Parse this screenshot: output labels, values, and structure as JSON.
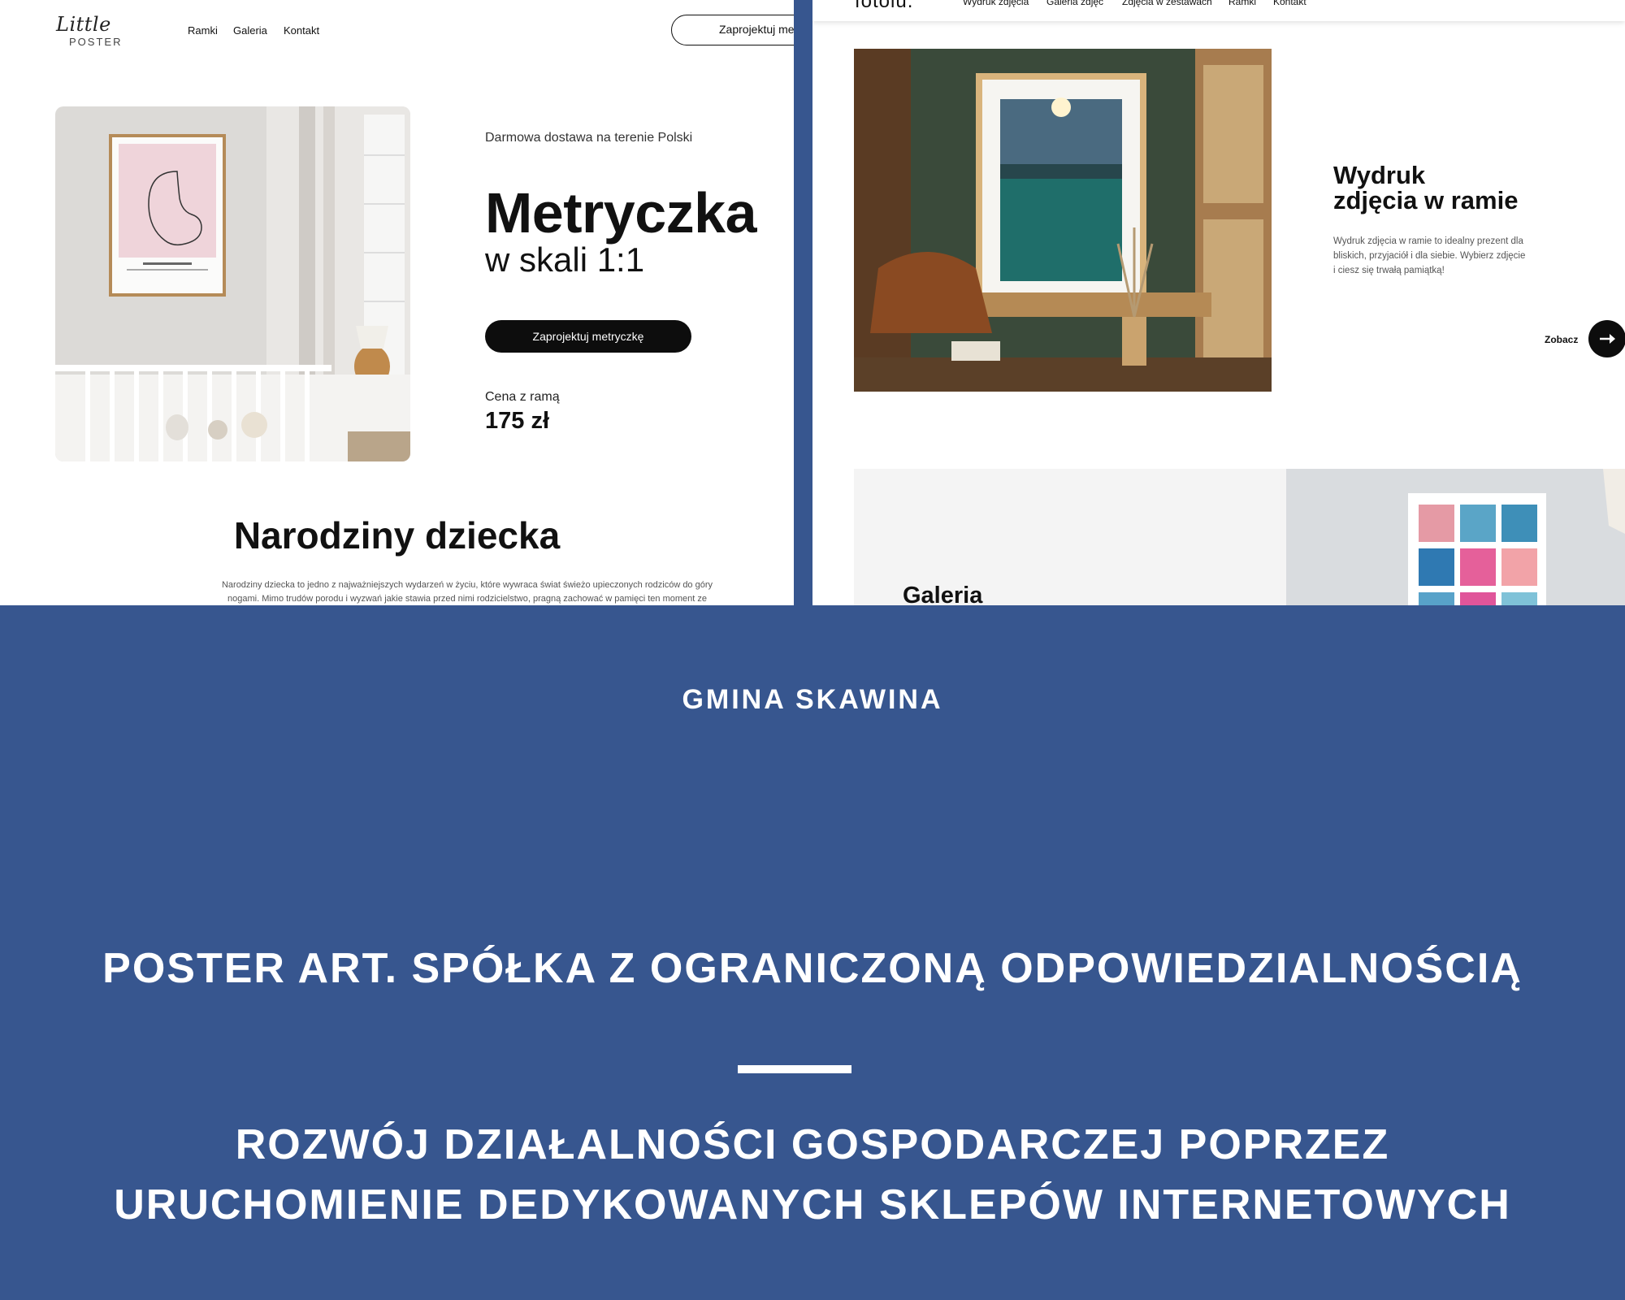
{
  "left_site": {
    "logo_script": "Little",
    "logo_caps": "POSTER",
    "nav": [
      "Ramki",
      "Galeria",
      "Kontakt"
    ],
    "header_cta": "Zaprojektuj me",
    "delivery_note": "Darmowa dostawa na terenie Polski",
    "hero_title": "Metryczka",
    "hero_subtitle": "w skali 1:1",
    "hero_button": "Zaprojektuj metryczkę",
    "price_label": "Cena z ramą",
    "price": "175 zł",
    "section_title": "Narodziny dziecka",
    "section_text": "Narodziny dziecka to jedno z najważniejszych wydarzeń w życiu, które wywraca świat świeżo upieczonych rodziców do góry nogami. Mimo trudów porodu i wyzwań jakie stawia przed nimi rodzicielstwo, pragną zachować w pamięci ten moment ze"
  },
  "right_site": {
    "logo": "fotolu.",
    "nav": [
      "Wydruk zdjęcia",
      "Galeria zdjęć",
      "Zdjęcia w zestawach",
      "Ramki",
      "Kontakt"
    ],
    "feature_title_line1": "Wydruk",
    "feature_title_line2": "zdjęcia w ramie",
    "feature_text": "Wydruk zdjęcia w ramie to idealny prezent dla bliskich, przyjaciół i dla siebie. Wybierz zdjęcie i ciesz się trwałą pamiątką!",
    "see_more": "Zobacz",
    "gallery_title": "Galeria"
  },
  "panel": {
    "municipality": "GMINA SKAWINA",
    "company": "POSTER ART. SPÓŁKA Z OGRANICZONĄ ODPOWIEDZIALNOŚCIĄ",
    "project_line1": "ROZWÓJ DZIAŁALNOŚCI GOSPODARCZEJ POPRZEZ",
    "project_line2": "URUCHOMIENIE DEDYKOWANYCH SKLEPÓW INTERNETOWYCH"
  },
  "colors": {
    "panel_blue": "#37568f",
    "button_black": "#0d0d0d"
  }
}
